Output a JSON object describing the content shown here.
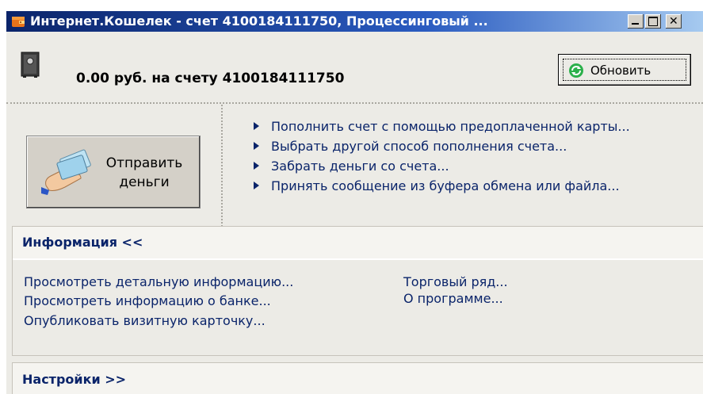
{
  "window": {
    "title": "Интернет.Кошелек - счет 4100184111750, Процессинговый ...",
    "title_gradient_start": "#0a246a",
    "title_gradient_end": "#a6caf0"
  },
  "balance": {
    "text": "0.00 руб. на счету  4100184111750"
  },
  "toolbar": {
    "refresh_label": "Обновить"
  },
  "send_money": {
    "label": "Отправить деньги"
  },
  "actions": [
    {
      "label": "Пополнить счет с помощью предоплаченной карты..."
    },
    {
      "label": "Выбрать другой способ пополнения счета..."
    },
    {
      "label": "Забрать деньги со счета..."
    },
    {
      "label": "Принять сообщение из буфера обмена или файла..."
    }
  ],
  "info": {
    "title": "Информация <<",
    "links_left": [
      {
        "label": "Просмотреть детальную информацию..."
      },
      {
        "label": "Просмотреть информацию о банке..."
      },
      {
        "label": "Опубликовать визитную карточку..."
      }
    ],
    "links_right": [
      {
        "label": "Торговый ряд..."
      },
      {
        "label": "О программе..."
      }
    ]
  },
  "settings": {
    "title": "Настройки >>"
  },
  "colors": {
    "link": "#0a246a",
    "background": "#ecebe6",
    "panel_header": "#f5f4f0",
    "refresh_icon": "#2bb04a"
  },
  "icons": [
    "wallet-app-icon",
    "safe-icon",
    "refresh-icon",
    "money-hand-icon",
    "arrow-bullet-icon"
  ]
}
